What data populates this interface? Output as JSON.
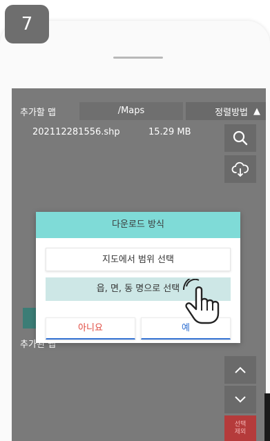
{
  "step": {
    "number": "7"
  },
  "header": {
    "add_map_label": "추가할 맵",
    "path": "/Maps",
    "sort_label": "정렬방법",
    "sort_arrow": "▲"
  },
  "file": {
    "name": "202112281556.shp",
    "size": "15.29 MB"
  },
  "added_maps_label": "추가된 맵",
  "dialog": {
    "title": "다운로드 방식",
    "option_map_range": "지도에서 범위 선택",
    "option_region_name": "읍, 면, 동 명으로 선택",
    "no_label": "아니요",
    "yes_label": "예"
  },
  "side_buttons": {
    "select_delete_line1": "선택",
    "select_delete_line2": "제외"
  },
  "icons": [
    "search-icon",
    "cloud-download-icon",
    "chevron-up-icon",
    "chevron-down-icon",
    "pointing-hand-icon"
  ],
  "colors": {
    "dialog_header": "#7fdbd7",
    "selected_option": "#cde7e6",
    "no_button_text": "#e0483e",
    "yes_button_text": "#2f6fd1",
    "select_button": "#b53b3b"
  }
}
